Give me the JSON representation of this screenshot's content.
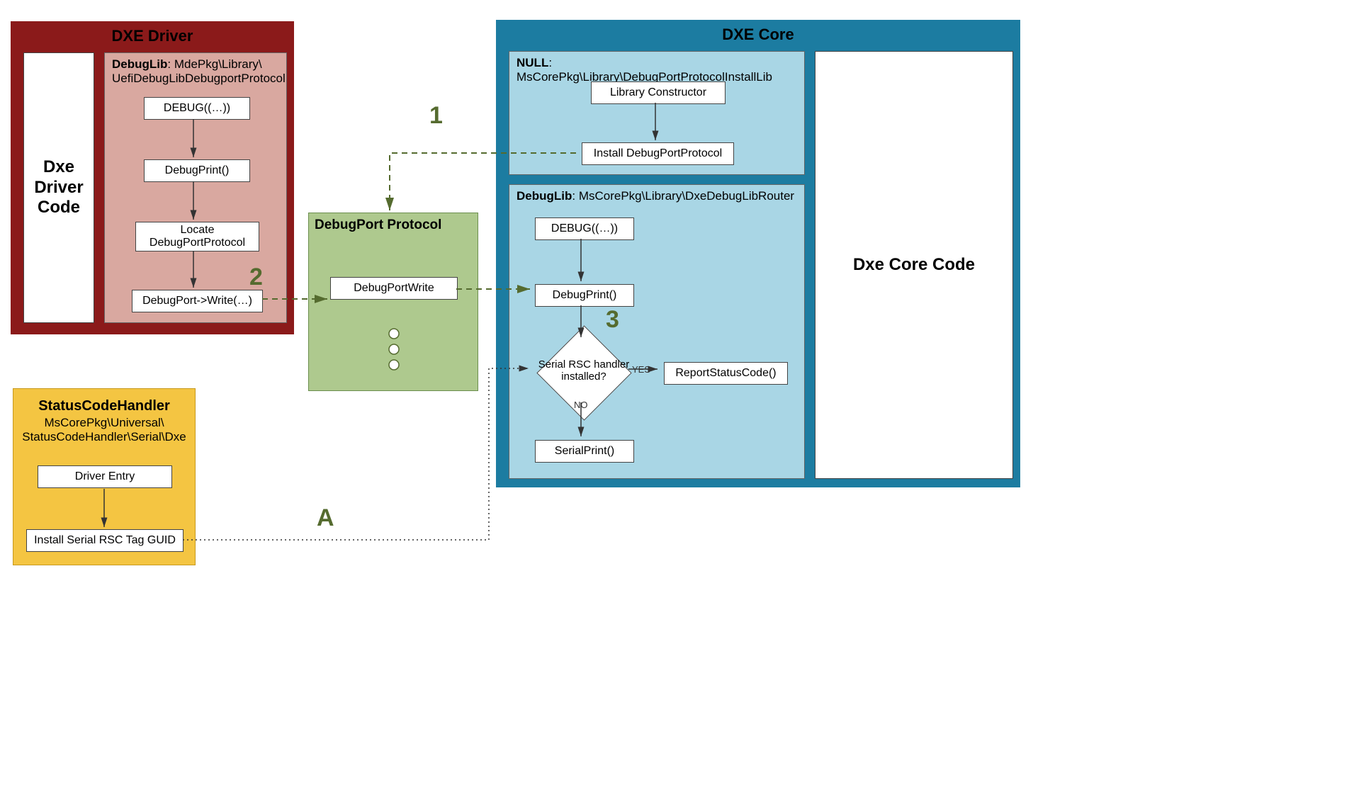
{
  "dxeDriver": {
    "title": "DXE Driver",
    "leftBox": "Dxe Driver Code",
    "debugLibLabelBold": "DebugLib",
    "debugLibLabelRest": ": MdePkg\\Library\\ UefiDebugLibDebugportProtocol",
    "steps": {
      "debugMacro": "DEBUG((…))",
      "debugPrint": "DebugPrint()",
      "locate": "Locate DebugPortProtocol",
      "write": "DebugPort->Write(…)"
    }
  },
  "debugPort": {
    "title": "DebugPort Protocol",
    "write": "DebugPortWrite"
  },
  "dxeCore": {
    "title": "DXE Core",
    "rightBox": "Dxe Core Code",
    "nullLib": {
      "labelBold": "NULL",
      "labelRest": ": MsCorePkg\\Library\\DebugPortProtocolInstallLib",
      "constructor": "Library Constructor",
      "install": "Install DebugPortProtocol"
    },
    "debugLib": {
      "labelBold": "DebugLib",
      "labelRest": ": MsCorePkg\\Library\\DxeDebugLibRouter",
      "debugMacro": "DEBUG((…))",
      "debugPrint": "DebugPrint()",
      "decision": "Serial RSC handler installed?",
      "yes": "YES",
      "no": "NO",
      "report": "ReportStatusCode()",
      "serial": "SerialPrint()"
    }
  },
  "statusCodeHandler": {
    "title": "StatusCodeHandler",
    "subtitle": "MsCorePkg\\Universal\\ StatusCodeHandler\\Serial\\Dxe",
    "entry": "Driver Entry",
    "install": "Install Serial RSC Tag GUID"
  },
  "labels": {
    "l1": "1",
    "l2": "2",
    "l3": "3",
    "lA": "A"
  },
  "colors": {
    "dxeDriverBorder": "#8b1a1a",
    "dxeDriverInner": "#d9a8a0",
    "dxeCoreBorder": "#1c7ca1",
    "dxeCoreInner": "#a9d6e5",
    "debugPort": "#aec98e",
    "status": "#f4c542",
    "olive": "#556b2f"
  }
}
